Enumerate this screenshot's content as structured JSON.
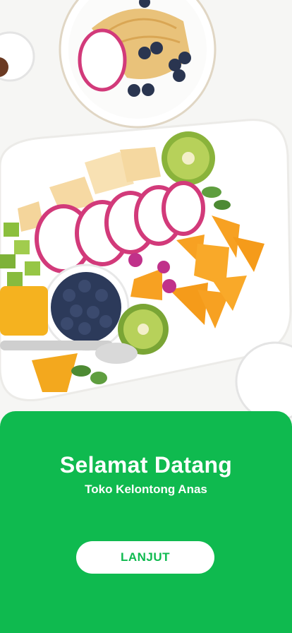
{
  "hero": {
    "image": "fruit-platter-photo"
  },
  "welcome": {
    "title": "Selamat Datang",
    "subtitle": "Toko Kelontong Anas",
    "button_label": "LANJUT"
  },
  "colors": {
    "accent": "#0fba4f",
    "button_bg": "#ffffff",
    "text_on_accent": "#ffffff"
  }
}
